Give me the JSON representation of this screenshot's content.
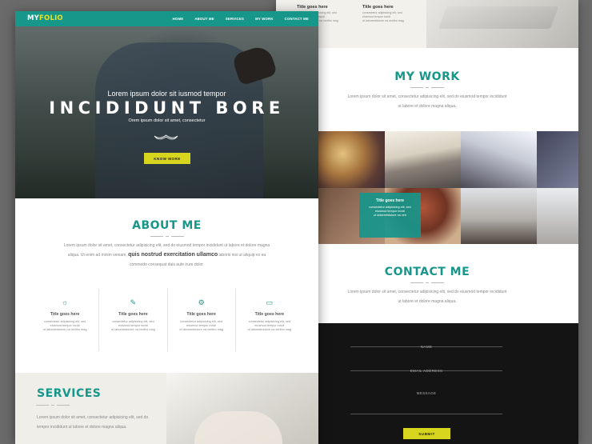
{
  "logo": {
    "my": "MY",
    "folio": "FOLIO"
  },
  "nav": [
    "HOME",
    "ABOUT ME",
    "SERVICES",
    "MY WORK",
    "CONTACT ME"
  ],
  "hero": {
    "subtitle": "Lorem ipsum dolor sit iusmod tempor",
    "headline": "INCIDIDUNT BORE",
    "small": "Orem ipsum dolor sit amet, consectetur",
    "button": "KNOW MORE"
  },
  "about": {
    "title": "ABOUT ME",
    "para_1": "Lorem ipsum dolor sit amet, consectetur adipisicing elit, sed do eiusmod tempor incididunt ut labore et dolore magna",
    "para_2_start": "aliqua. Ut enim ad minim veniam,",
    "para_2_bold": "quis nostrud exercitation ullamco",
    "para_2_end": "laboris nisi ut aliquip ex ea",
    "para_3": "commodo consequat duis aute irure dolor.",
    "features": [
      {
        "icon": "lightbulb-icon",
        "title": "Title goes here",
        "text_1": "consectetur adipisicing elit, sed",
        "text_2": "eiusmod tempor incidi",
        "text_3": "ut laboreetdolore na veritho mag"
      },
      {
        "icon": "pencil-icon",
        "title": "Title goes here",
        "text_1": "consectetur adipisicing elit, sed",
        "text_2": "eiusmod tempor incidi",
        "text_3": "ut laboreetdolore na veritho mag"
      },
      {
        "icon": "gear-icon",
        "title": "Title goes here",
        "text_1": "consectetur adipisicing elit, sed",
        "text_2": "eiusmod tempor incidi",
        "text_3": "ut laboreetdolore na veritho mag"
      },
      {
        "icon": "laptop-icon",
        "title": "Title goes here",
        "text_1": "consectetur adipisicing elit, sed",
        "text_2": "eiusmod tempor incidi",
        "text_3": "ut laboreetdolore na veritho mag"
      }
    ]
  },
  "services": {
    "title": "SERVICES",
    "para_1": "Lorem ipsum dolor sit amet, consectetur adipisicing elit, sed do",
    "para_2": "tempor incididunt ut labore et dolore magna aliqua."
  },
  "right_top": {
    "features": [
      {
        "title": "Title goes here",
        "text_1": "consectetur adipisicing elit, sed",
        "text_2": "eiusmod tempor incidi",
        "text_3": "ut laboreetdolore na veritho mag"
      },
      {
        "title": "Title goes here",
        "text_1": "consectetur adipisicing elit, sed",
        "text_2": "eiusmod tempor incidi",
        "text_3": "ut laboreetdolore na veritho mag"
      }
    ]
  },
  "work": {
    "title": "MY WORK",
    "para_1": "Lorem ipsum dolor sit amet, consectetur adipisicing elit, sed do eiusmod tempor incididunt",
    "para_2": "ut labore et dolore magna aliqua.",
    "overlay_title": "Title goes here",
    "overlay_text_1": "consectetur adipisicing elit, sed",
    "overlay_text_2": "eiusmod tempor incidi",
    "overlay_text_3": "ut doloreetdolore na veri"
  },
  "contact": {
    "title": "CONTACT ME",
    "para_1": "Lorem ipsum dolor sit amet, consectetur adipisicing elit, sed do eiusmod tempor incididunt",
    "para_2": "ut labore et dolore magna aliqua.",
    "field_name": "NAME",
    "field_email": "EMAIL ADDRESS",
    "field_message": "MESSAGE",
    "submit": "SUBMIT"
  },
  "colors": {
    "accent": "#17968a",
    "yellow": "#d8d51f",
    "dark": "#141414"
  }
}
